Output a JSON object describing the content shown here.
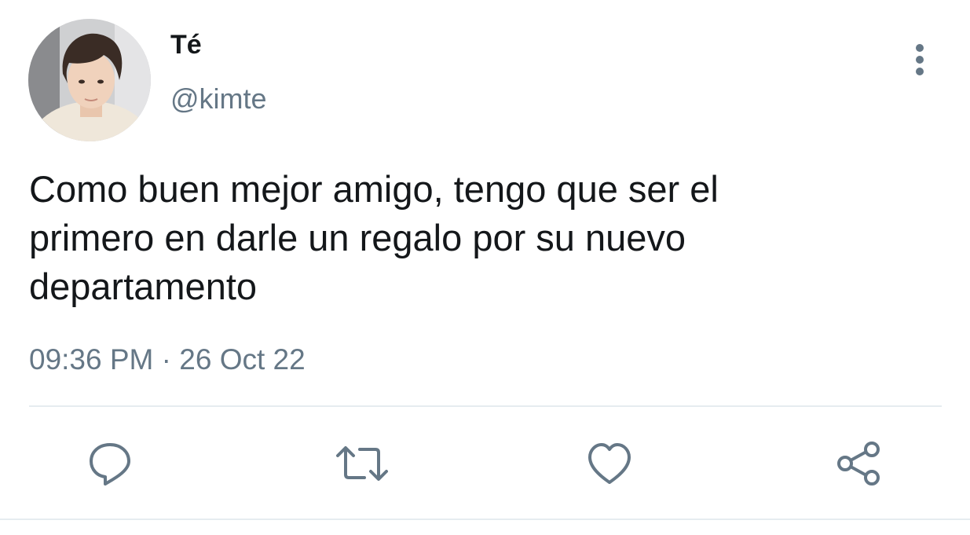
{
  "tweet": {
    "author": {
      "display_name": "Té",
      "handle": "@kimte",
      "avatar_icon": "profile-photo"
    },
    "text": "Como buen mejor amigo, tengo que ser el\nprimero en darle un regalo por su nuevo\ndepartamento",
    "time": "09:36 PM",
    "separator": "·",
    "date": "26 Oct 22"
  },
  "actions": [
    {
      "name": "reply",
      "icon": "reply-icon"
    },
    {
      "name": "retweet",
      "icon": "retweet-icon"
    },
    {
      "name": "like",
      "icon": "heart-icon"
    },
    {
      "name": "share",
      "icon": "share-icon"
    }
  ],
  "menu": {
    "icon": "more-vertical-icon"
  },
  "colors": {
    "text_primary": "#14171a",
    "text_secondary": "#657786",
    "divider": "#e6ecf0",
    "background": "#ffffff"
  }
}
